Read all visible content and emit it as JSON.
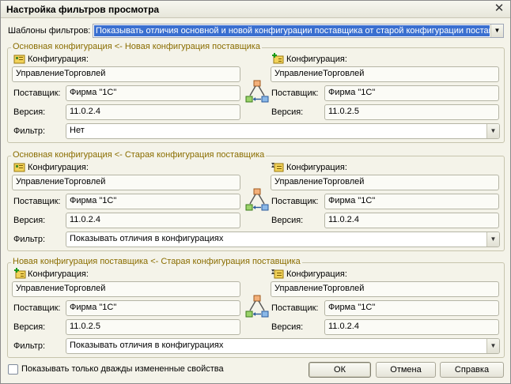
{
  "window": {
    "title": "Настройка фильтров просмотра",
    "close_glyph": "✕"
  },
  "templates": {
    "label": "Шаблоны фильтров:",
    "value": "Показывать отличия основной и новой конфигурации поставщика от старой конфигурации поставщика"
  },
  "groups": [
    {
      "title": "Основная конфигурация <- Новая конфигурация поставщика",
      "left": {
        "icon": "main-config-icon",
        "config_label": "Конфигурация:",
        "config": "УправлениеТорговлей",
        "vendor_label": "Поставщик:",
        "vendor": "Фирма \"1С\"",
        "version_label": "Версия:",
        "version": "11.0.2.4"
      },
      "right": {
        "icon": "vendor-config-icon",
        "config_label": "Конфигурация:",
        "config": "УправлениеТорговлей",
        "vendor_label": "Поставщик:",
        "vendor": "Фирма \"1С\"",
        "version_label": "Версия:",
        "version": "11.0.2.5"
      },
      "filter_label": "Фильтр:",
      "filter": "Нет"
    },
    {
      "title": "Основная конфигурация <- Старая конфигурация поставщика",
      "left": {
        "icon": "main-config-icon",
        "config_label": "Конфигурация:",
        "config": "УправлениеТорговлей",
        "vendor_label": "Поставщик:",
        "vendor": "Фирма \"1С\"",
        "version_label": "Версия:",
        "version": "11.0.2.4"
      },
      "right": {
        "icon": "old-vendor-config-icon",
        "config_label": "Конфигурация:",
        "config": "УправлениеТорговлей",
        "vendor_label": "Поставщик:",
        "vendor": "Фирма \"1С\"",
        "version_label": "Версия:",
        "version": "11.0.2.4"
      },
      "filter_label": "Фильтр:",
      "filter": "Показывать отличия в конфигурациях"
    },
    {
      "title": "Новая конфигурация поставщика <- Старая конфигурация поставщика",
      "left": {
        "icon": "vendor-config-icon",
        "config_label": "Конфигурация:",
        "config": "УправлениеТорговлей",
        "vendor_label": "Поставщик:",
        "vendor": "Фирма \"1С\"",
        "version_label": "Версия:",
        "version": "11.0.2.5"
      },
      "right": {
        "icon": "old-vendor-config-icon",
        "config_label": "Конфигурация:",
        "config": "УправлениеТорговлей",
        "vendor_label": "Поставщик:",
        "vendor": "Фирма \"1С\"",
        "version_label": "Версия:",
        "version": "11.0.2.4"
      },
      "filter_label": "Фильтр:",
      "filter": "Показывать отличия в конфигурациях"
    }
  ],
  "footer": {
    "checkbox_label": "Показывать только дважды измененные свойства",
    "ok": "ОК",
    "cancel": "Отмена",
    "help": "Справка"
  },
  "colors": {
    "group_title": "#8a6d00",
    "selection": "#3a6fd0"
  },
  "icons": {
    "dropdown": "▼",
    "swap": "compare-arrows-icon"
  }
}
